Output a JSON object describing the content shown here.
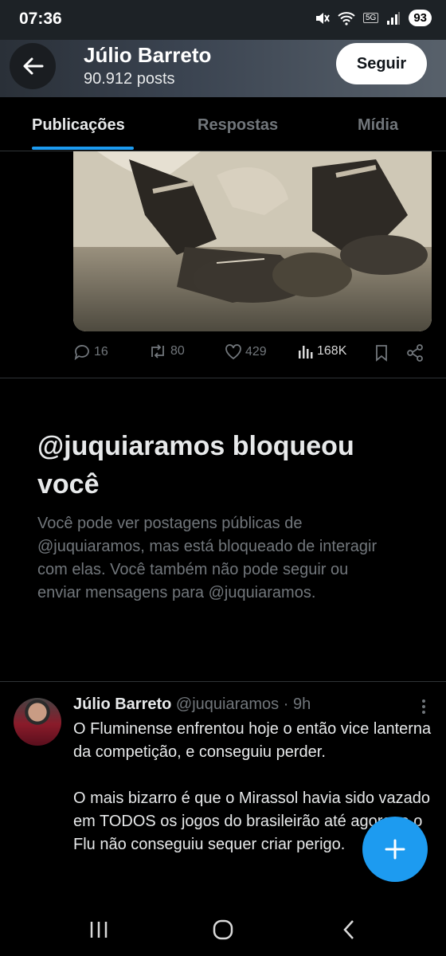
{
  "status_bar": {
    "time": "07:36",
    "network": "5G",
    "battery": "93"
  },
  "header": {
    "name": "Júlio Barreto",
    "post_count": "90.912 posts",
    "follow_label": "Seguir"
  },
  "tabs": [
    {
      "label": "Publicações",
      "active": true
    },
    {
      "label": "Respostas",
      "active": false
    },
    {
      "label": "Mídia",
      "active": false
    }
  ],
  "post_actions": {
    "replies": "16",
    "reposts": "80",
    "likes": "429",
    "views": "168K"
  },
  "blocked": {
    "title": "@juquiaramos bloqueou você",
    "body": "Você pode ver postagens públicas de @juquiaramos, mas está bloqueado de interagir com elas. Você também não pode seguir ou enviar mensagens para @juquiaramos."
  },
  "tweet": {
    "name": "Júlio Barreto",
    "handle": "@juquiaramos",
    "time": "· 9h",
    "text": "O Fluminense enfrentou hoje o então vice lanterna da competição, e conseguiu perder.\n\nO mais bizarro é que o Mirassol havia sido vazado em TODOS os jogos do brasileirão até agora, e o Flu não conseguiu sequer criar perigo."
  },
  "colors": {
    "accent": "#1d9bf0",
    "background": "#000000",
    "muted": "#71767b"
  }
}
